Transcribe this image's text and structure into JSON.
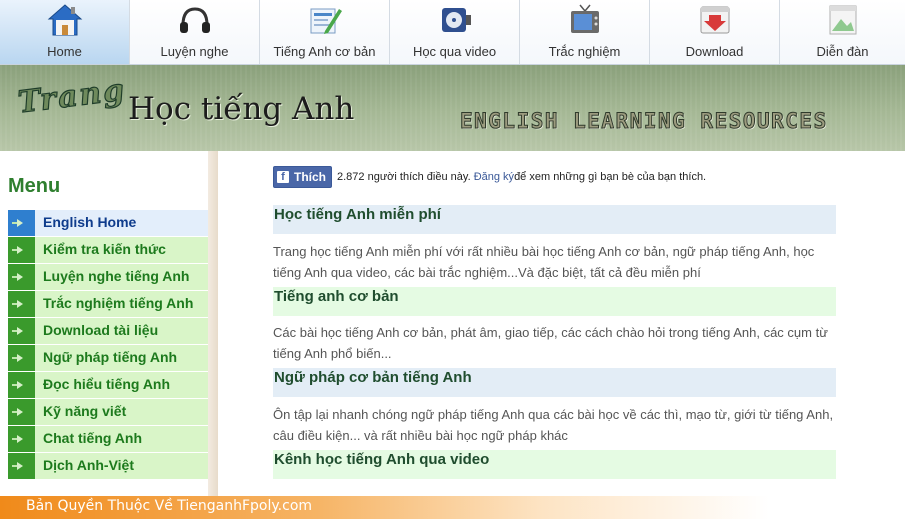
{
  "nav": {
    "items": [
      {
        "label": "Home",
        "icon": "home-icon"
      },
      {
        "label": "Luyện nghe",
        "icon": "headphones-icon"
      },
      {
        "label": "Tiếng Anh cơ bản",
        "icon": "edit-document-icon"
      },
      {
        "label": "Học qua video",
        "icon": "film-reel-icon"
      },
      {
        "label": "Trắc nghiệm",
        "icon": "tv-icon"
      },
      {
        "label": "Download",
        "icon": "download-icon"
      },
      {
        "label": "Diễn đàn",
        "icon": "image-icon"
      }
    ]
  },
  "banner": {
    "trang": "Trang",
    "title": "Học tiếng Anh",
    "tagline": "ENGLISH LEARNING RESOURCES"
  },
  "sidebar": {
    "title": "Menu",
    "items": [
      {
        "label": "English Home"
      },
      {
        "label": "Kiểm tra kiến thức"
      },
      {
        "label": "Luyện nghe tiếng Anh"
      },
      {
        "label": "Trắc nghiệm tiếng Anh"
      },
      {
        "label": "Download tài liệu"
      },
      {
        "label": "Ngữ pháp tiếng Anh"
      },
      {
        "label": "Đọc hiểu tiếng Anh"
      },
      {
        "label": "Kỹ năng viết"
      },
      {
        "label": "Chat tiếng Anh"
      },
      {
        "label": "Dịch Anh-Việt"
      }
    ]
  },
  "like": {
    "button": "Thích",
    "count_text": "2.872 người thích điều này.",
    "signup": "Đăng ký",
    "after": "để xem những gì bạn bè của bạn thích."
  },
  "sections": [
    {
      "title": "Học tiếng Anh miễn phí",
      "desc": "Trang học tiếng Anh miễn phí với rất nhiều bài học tiếng Anh cơ bản, ngữ pháp tiếng Anh, học tiếng Anh qua video, các bài trắc nghiệm...Và đặc biệt, tất cả đều miễn phí"
    },
    {
      "title": "Tiếng anh cơ bản",
      "desc": "Các bài học tiếng Anh cơ bản, phát âm, giao tiếp, các cách chào hỏi trong tiếng Anh, các cụm từ tiếng Anh phổ biến..."
    },
    {
      "title": "Ngữ pháp cơ bản tiếng Anh",
      "desc": "Ôn tập lại nhanh chóng ngữ pháp tiếng Anh qua các bài học về các thì, mạo từ, giới từ tiếng Anh, câu điều kiện... và rất nhiều bài học ngữ pháp khác"
    },
    {
      "title": "Kênh học tiếng Anh qua video",
      "desc": ""
    }
  ],
  "footer": {
    "text": "Bản Quyền Thuộc Về TienganhFpoly.com"
  },
  "colors": {
    "menu_green": "#3a9a2c",
    "section_blue": "#e3edf6",
    "section_green": "#e5fbe3",
    "footer_orange": "#f08a1a"
  }
}
